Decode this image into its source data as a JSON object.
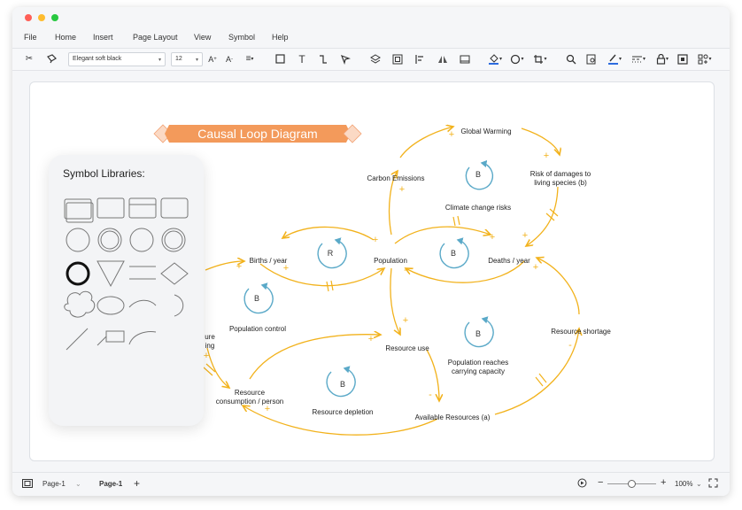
{
  "window": {
    "traffic_lights": [
      "#ff5f57",
      "#febc2e",
      "#28c840"
    ]
  },
  "menu": [
    "File",
    "Home",
    "Insert",
    "Page Layout",
    "View",
    "Symbol",
    "Help"
  ],
  "toolbar": {
    "font_family": "Elegant soft black",
    "font_size": "12",
    "icons": [
      "cut-icon",
      "format-painter-icon",
      "grow-font-icon",
      "shrink-font-icon",
      "align-icon",
      "rectangle-icon",
      "text-icon",
      "connector-icon",
      "pointer-icon",
      "layers-icon",
      "group-icon",
      "align-left-icon",
      "flip-icon",
      "distribute-icon",
      "fill-icon",
      "shadow-icon",
      "crop-icon",
      "search-icon",
      "replace-icon",
      "line-color-icon",
      "line-style-icon",
      "lock-icon",
      "frame-icon",
      "more-icon"
    ]
  },
  "diagram": {
    "title": "Causal Loop Diagram",
    "title_color": "#f39a5b",
    "arrow_color": "#f2b21c",
    "loop_color": "#5aa9c8",
    "nodes": {
      "global_warming": "Global Warming",
      "carbon_emissions": "Carbon Emissions",
      "risk_damages": [
        "Risk of damages to",
        "living species (b)"
      ],
      "climate_risks": "Climate change risks",
      "births": "Births / year",
      "population": "Population",
      "deaths": "Deaths / year",
      "population_control": "Population control",
      "resource_shortage": "Resource shortage",
      "resource_use": "Resource use",
      "reaches_capacity": [
        "Population reaches",
        "carrying capacity"
      ],
      "resource_consumption": [
        "Resource",
        "consumption / person"
      ],
      "resource_depletion": "Resource depletion",
      "available_resources": "Available Resources (a)",
      "partial_label": [
        "ure",
        "ing"
      ]
    },
    "loops": [
      "B",
      "R",
      "B",
      "B",
      "B",
      "B"
    ],
    "signs": [
      "+",
      "-"
    ]
  },
  "symbol_library": {
    "title": "Symbol Libraries:"
  },
  "status": {
    "page_selector": "Page-1",
    "active_tab": "Page-1",
    "add_page": "+",
    "zoom": "100%",
    "zoom_minus": "−",
    "zoom_plus": "+"
  }
}
